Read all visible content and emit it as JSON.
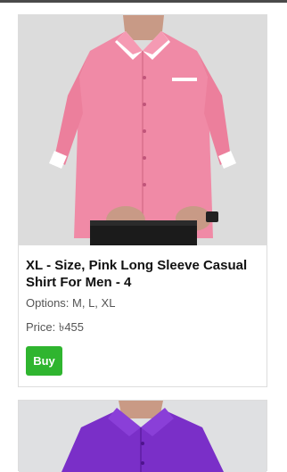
{
  "products": [
    {
      "title": "XL - Size, Pink Long Sleeve Casual Shirt For Men - 4",
      "options": "Options: M, L, XL",
      "price": "Price: ৳455",
      "buy_label": "Buy",
      "image": "pink-long-sleeve-shirt-photo"
    },
    {
      "image": "purple-shirt-photo"
    }
  ],
  "colors": {
    "buy_button": "#2fb52f",
    "card_border": "#dddddd",
    "shirt_pink": "#f08aa6",
    "shirt_purple": "#7a2fc8"
  }
}
